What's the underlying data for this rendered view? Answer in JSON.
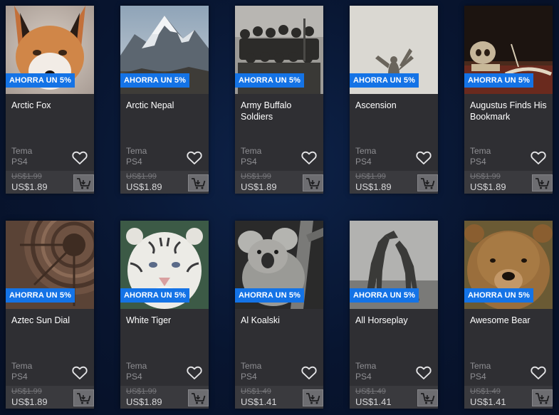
{
  "cards": [
    {
      "title": "Arctic Fox",
      "badge": "AHORRA UN 5%",
      "type": "Tema",
      "platform": "PS4",
      "old_price": "US$1.99",
      "new_price": "US$1.89"
    },
    {
      "title": "Arctic Nepal",
      "badge": "AHORRA UN 5%",
      "type": "Tema",
      "platform": "PS4",
      "old_price": "US$1.99",
      "new_price": "US$1.89"
    },
    {
      "title": "Army Buffalo Soldiers",
      "badge": "AHORRA UN 5%",
      "type": "Tema",
      "platform": "PS4",
      "old_price": "US$1.99",
      "new_price": "US$1.89"
    },
    {
      "title": "Ascension",
      "badge": "AHORRA UN 5%",
      "type": "Tema",
      "platform": "PS4",
      "old_price": "US$1.99",
      "new_price": "US$1.89"
    },
    {
      "title": "Augustus Finds His Bookmark",
      "badge": "AHORRA UN 5%",
      "type": "Tema",
      "platform": "PS4",
      "old_price": "US$1.99",
      "new_price": "US$1.89"
    },
    {
      "title": "Aztec Sun Dial",
      "badge": "AHORRA UN 5%",
      "type": "Tema",
      "platform": "PS4",
      "old_price": "US$1.99",
      "new_price": "US$1.89"
    },
    {
      "title": "White Tiger",
      "badge": "AHORRA UN 5%",
      "type": "Tema",
      "platform": "PS4",
      "old_price": "US$1.99",
      "new_price": "US$1.89"
    },
    {
      "title": "Al Koalski",
      "badge": "AHORRA UN 5%",
      "type": "Tema",
      "platform": "PS4",
      "old_price": "US$1.49",
      "new_price": "US$1.41"
    },
    {
      "title": "All Horseplay",
      "badge": "AHORRA UN 5%",
      "type": "Tema",
      "platform": "PS4",
      "old_price": "US$1.49",
      "new_price": "US$1.41"
    },
    {
      "title": "Awesome Bear",
      "badge": "AHORRA UN 5%",
      "type": "Tema",
      "platform": "PS4",
      "old_price": "US$1.49",
      "new_price": "US$1.41"
    }
  ],
  "icons": {
    "wishlist": "heart-outline-icon",
    "cart": "add-to-cart-icon"
  },
  "colors": {
    "background": "#081530",
    "card": "#2f2f33",
    "badge": "#1473e6"
  }
}
